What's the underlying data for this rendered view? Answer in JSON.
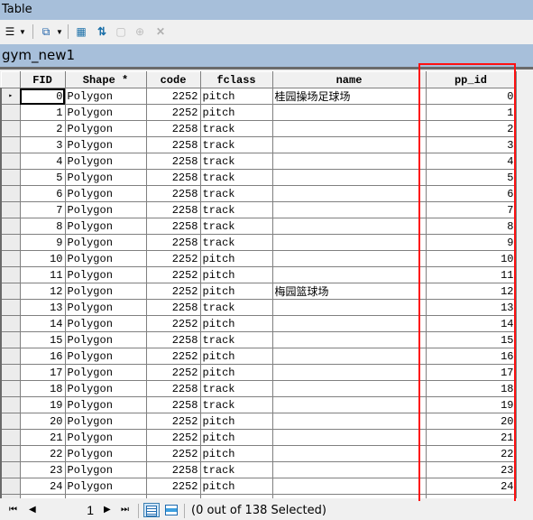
{
  "window": {
    "title": "Table"
  },
  "toolbar": {
    "buttons": [
      {
        "name": "table-options-icon",
        "glyph": "☰",
        "dropdown": true
      },
      {
        "name": "related-tables-icon",
        "glyph": "⧉",
        "dropdown": true
      },
      {
        "name": "select-by-attributes-icon",
        "glyph": "▦"
      },
      {
        "name": "switch-selection-icon",
        "glyph": "⇅"
      },
      {
        "name": "clear-selection-icon",
        "glyph": "▢"
      },
      {
        "name": "zoom-to-selected-icon",
        "glyph": "⊕"
      },
      {
        "name": "delete-selected-icon",
        "glyph": "✕"
      }
    ]
  },
  "layer": {
    "name": "gym_new1"
  },
  "table": {
    "columns": [
      "FID",
      "Shape *",
      "code",
      "fclass",
      "name",
      "pp_id"
    ],
    "rows": [
      [
        "0",
        "Polygon",
        "2252",
        "pitch",
        "桂园操场足球场",
        "0"
      ],
      [
        "1",
        "Polygon",
        "2252",
        "pitch",
        "",
        "1"
      ],
      [
        "2",
        "Polygon",
        "2258",
        "track",
        "",
        "2"
      ],
      [
        "3",
        "Polygon",
        "2258",
        "track",
        "",
        "3"
      ],
      [
        "4",
        "Polygon",
        "2258",
        "track",
        "",
        "4"
      ],
      [
        "5",
        "Polygon",
        "2258",
        "track",
        "",
        "5"
      ],
      [
        "6",
        "Polygon",
        "2258",
        "track",
        "",
        "6"
      ],
      [
        "7",
        "Polygon",
        "2258",
        "track",
        "",
        "7"
      ],
      [
        "8",
        "Polygon",
        "2258",
        "track",
        "",
        "8"
      ],
      [
        "9",
        "Polygon",
        "2258",
        "track",
        "",
        "9"
      ],
      [
        "10",
        "Polygon",
        "2252",
        "pitch",
        "",
        "10"
      ],
      [
        "11",
        "Polygon",
        "2252",
        "pitch",
        "",
        "11"
      ],
      [
        "12",
        "Polygon",
        "2252",
        "pitch",
        "梅园篮球场",
        "12"
      ],
      [
        "13",
        "Polygon",
        "2258",
        "track",
        "",
        "13"
      ],
      [
        "14",
        "Polygon",
        "2252",
        "pitch",
        "",
        "14"
      ],
      [
        "15",
        "Polygon",
        "2258",
        "track",
        "",
        "15"
      ],
      [
        "16",
        "Polygon",
        "2252",
        "pitch",
        "",
        "16"
      ],
      [
        "17",
        "Polygon",
        "2252",
        "pitch",
        "",
        "17"
      ],
      [
        "18",
        "Polygon",
        "2258",
        "track",
        "",
        "18"
      ],
      [
        "19",
        "Polygon",
        "2258",
        "track",
        "",
        "19"
      ],
      [
        "20",
        "Polygon",
        "2252",
        "pitch",
        "",
        "20"
      ],
      [
        "21",
        "Polygon",
        "2252",
        "pitch",
        "",
        "21"
      ],
      [
        "22",
        "Polygon",
        "2252",
        "pitch",
        "",
        "22"
      ],
      [
        "23",
        "Polygon",
        "2258",
        "track",
        "",
        "23"
      ],
      [
        "24",
        "Polygon",
        "2252",
        "pitch",
        "",
        "24"
      ]
    ],
    "current_row_marker": "▸",
    "highlight_color": "#ff1010"
  },
  "status": {
    "first_label": "⏮",
    "prev_label": "◀",
    "page": "1",
    "next_label": "▶",
    "last_label": "⏭",
    "selection_text": "(0 out of 138 Selected)"
  }
}
